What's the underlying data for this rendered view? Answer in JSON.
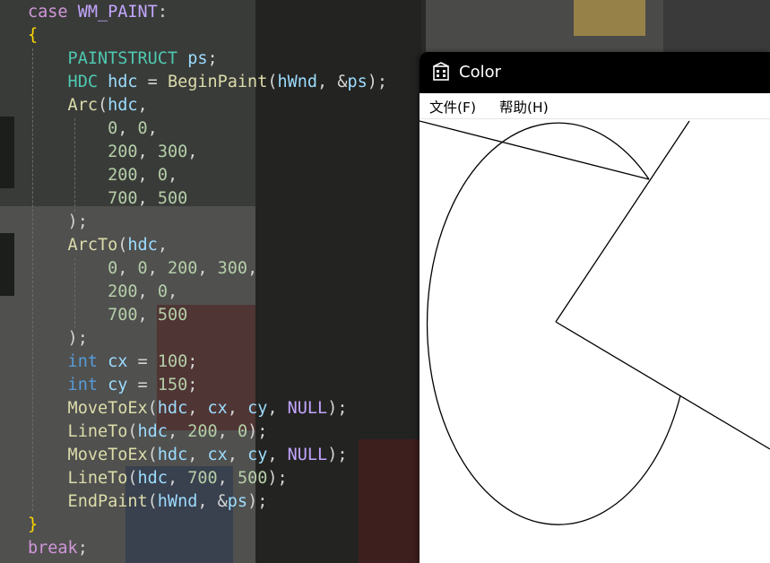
{
  "editor": {
    "lines": [
      [
        {
          "t": "case",
          "c": "kw-ctrl"
        },
        {
          "t": " WM_PAINT",
          "c": "macro"
        },
        {
          "t": ":",
          "c": "punct"
        }
      ],
      [
        {
          "t": "{",
          "c": "brace"
        }
      ],
      [
        {
          "t": "    PAINTSTRUCT",
          "c": "type"
        },
        {
          "t": " ps",
          "c": "var"
        },
        {
          "t": ";",
          "c": "punct"
        }
      ],
      [
        {
          "t": "    HDC",
          "c": "type"
        },
        {
          "t": " hdc",
          "c": "var"
        },
        {
          "t": " = ",
          "c": "punct"
        },
        {
          "t": "BeginPaint",
          "c": "fn"
        },
        {
          "t": "(",
          "c": "paren"
        },
        {
          "t": "hWnd",
          "c": "var"
        },
        {
          "t": ", &",
          "c": "punct"
        },
        {
          "t": "ps",
          "c": "var"
        },
        {
          "t": ");",
          "c": "punct"
        }
      ],
      [
        {
          "t": "    Arc",
          "c": "fn"
        },
        {
          "t": "(",
          "c": "paren"
        },
        {
          "t": "hdc",
          "c": "var"
        },
        {
          "t": ",",
          "c": "punct"
        }
      ],
      [
        {
          "t": "        0",
          "c": "num"
        },
        {
          "t": ", ",
          "c": "punct"
        },
        {
          "t": "0",
          "c": "num"
        },
        {
          "t": ",",
          "c": "punct"
        }
      ],
      [
        {
          "t": "        200",
          "c": "num"
        },
        {
          "t": ", ",
          "c": "punct"
        },
        {
          "t": "300",
          "c": "num"
        },
        {
          "t": ",",
          "c": "punct"
        }
      ],
      [
        {
          "t": "        200",
          "c": "num"
        },
        {
          "t": ", ",
          "c": "punct"
        },
        {
          "t": "0",
          "c": "num"
        },
        {
          "t": ",",
          "c": "punct"
        }
      ],
      [
        {
          "t": "        700",
          "c": "num"
        },
        {
          "t": ", ",
          "c": "punct"
        },
        {
          "t": "500",
          "c": "num"
        }
      ],
      [
        {
          "t": "    );",
          "c": "punct"
        }
      ],
      [
        {
          "t": "    ArcTo",
          "c": "fn"
        },
        {
          "t": "(",
          "c": "paren"
        },
        {
          "t": "hdc",
          "c": "var"
        },
        {
          "t": ",",
          "c": "punct"
        }
      ],
      [
        {
          "t": "        0",
          "c": "num"
        },
        {
          "t": ", ",
          "c": "punct"
        },
        {
          "t": "0",
          "c": "num"
        },
        {
          "t": ", ",
          "c": "punct"
        },
        {
          "t": "200",
          "c": "num"
        },
        {
          "t": ", ",
          "c": "punct"
        },
        {
          "t": "300",
          "c": "num"
        },
        {
          "t": ",",
          "c": "punct"
        }
      ],
      [
        {
          "t": "        200",
          "c": "num"
        },
        {
          "t": ", ",
          "c": "punct"
        },
        {
          "t": "0",
          "c": "num"
        },
        {
          "t": ",",
          "c": "punct"
        }
      ],
      [
        {
          "t": "        700",
          "c": "num"
        },
        {
          "t": ", ",
          "c": "punct"
        },
        {
          "t": "500",
          "c": "num"
        }
      ],
      [
        {
          "t": "    );",
          "c": "punct"
        }
      ],
      [
        {
          "t": "    int",
          "c": "kw"
        },
        {
          "t": " cx",
          "c": "var"
        },
        {
          "t": " = ",
          "c": "punct"
        },
        {
          "t": "100",
          "c": "num"
        },
        {
          "t": ";",
          "c": "punct"
        }
      ],
      [
        {
          "t": "    int",
          "c": "kw"
        },
        {
          "t": " cy",
          "c": "var"
        },
        {
          "t": " = ",
          "c": "punct"
        },
        {
          "t": "150",
          "c": "num"
        },
        {
          "t": ";",
          "c": "punct"
        }
      ],
      [
        {
          "t": "    MoveToEx",
          "c": "fn"
        },
        {
          "t": "(",
          "c": "paren"
        },
        {
          "t": "hdc",
          "c": "var"
        },
        {
          "t": ", ",
          "c": "punct"
        },
        {
          "t": "cx",
          "c": "var"
        },
        {
          "t": ", ",
          "c": "punct"
        },
        {
          "t": "cy",
          "c": "var"
        },
        {
          "t": ", ",
          "c": "punct"
        },
        {
          "t": "NULL",
          "c": "macro"
        },
        {
          "t": ");",
          "c": "punct"
        }
      ],
      [
        {
          "t": "    LineTo",
          "c": "fn"
        },
        {
          "t": "(",
          "c": "paren"
        },
        {
          "t": "hdc",
          "c": "var"
        },
        {
          "t": ", ",
          "c": "punct"
        },
        {
          "t": "200",
          "c": "num"
        },
        {
          "t": ", ",
          "c": "punct"
        },
        {
          "t": "0",
          "c": "num"
        },
        {
          "t": ");",
          "c": "punct"
        }
      ],
      [
        {
          "t": "    MoveToEx",
          "c": "fn"
        },
        {
          "t": "(",
          "c": "paren"
        },
        {
          "t": "hdc",
          "c": "var"
        },
        {
          "t": ", ",
          "c": "punct"
        },
        {
          "t": "cx",
          "c": "var"
        },
        {
          "t": ", ",
          "c": "punct"
        },
        {
          "t": "cy",
          "c": "var"
        },
        {
          "t": ", ",
          "c": "punct"
        },
        {
          "t": "NULL",
          "c": "macro"
        },
        {
          "t": ");",
          "c": "punct"
        }
      ],
      [
        {
          "t": "    LineTo",
          "c": "fn"
        },
        {
          "t": "(",
          "c": "paren"
        },
        {
          "t": "hdc",
          "c": "var"
        },
        {
          "t": ", ",
          "c": "punct"
        },
        {
          "t": "700",
          "c": "num"
        },
        {
          "t": ", ",
          "c": "punct"
        },
        {
          "t": "500",
          "c": "num"
        },
        {
          "t": ");",
          "c": "punct"
        }
      ],
      [
        {
          "t": "    EndPaint",
          "c": "fn"
        },
        {
          "t": "(",
          "c": "paren"
        },
        {
          "t": "hWnd",
          "c": "var"
        },
        {
          "t": ", &",
          "c": "punct"
        },
        {
          "t": "ps",
          "c": "var"
        },
        {
          "t": ");",
          "c": "punct"
        }
      ],
      [
        {
          "t": "}",
          "c": "brace"
        }
      ],
      [
        {
          "t": "break",
          "c": "kw-ctrl"
        },
        {
          "t": ";",
          "c": "punct"
        }
      ]
    ]
  },
  "window": {
    "title": "Color",
    "icon": "app-window-icon",
    "menu": [
      {
        "label": "文件(F)"
      },
      {
        "label": "帮助(H)"
      }
    ]
  },
  "colors": {
    "titlebar_bg": "#000000",
    "client_bg": "#ffffff",
    "drawing_stroke": "#000000"
  }
}
